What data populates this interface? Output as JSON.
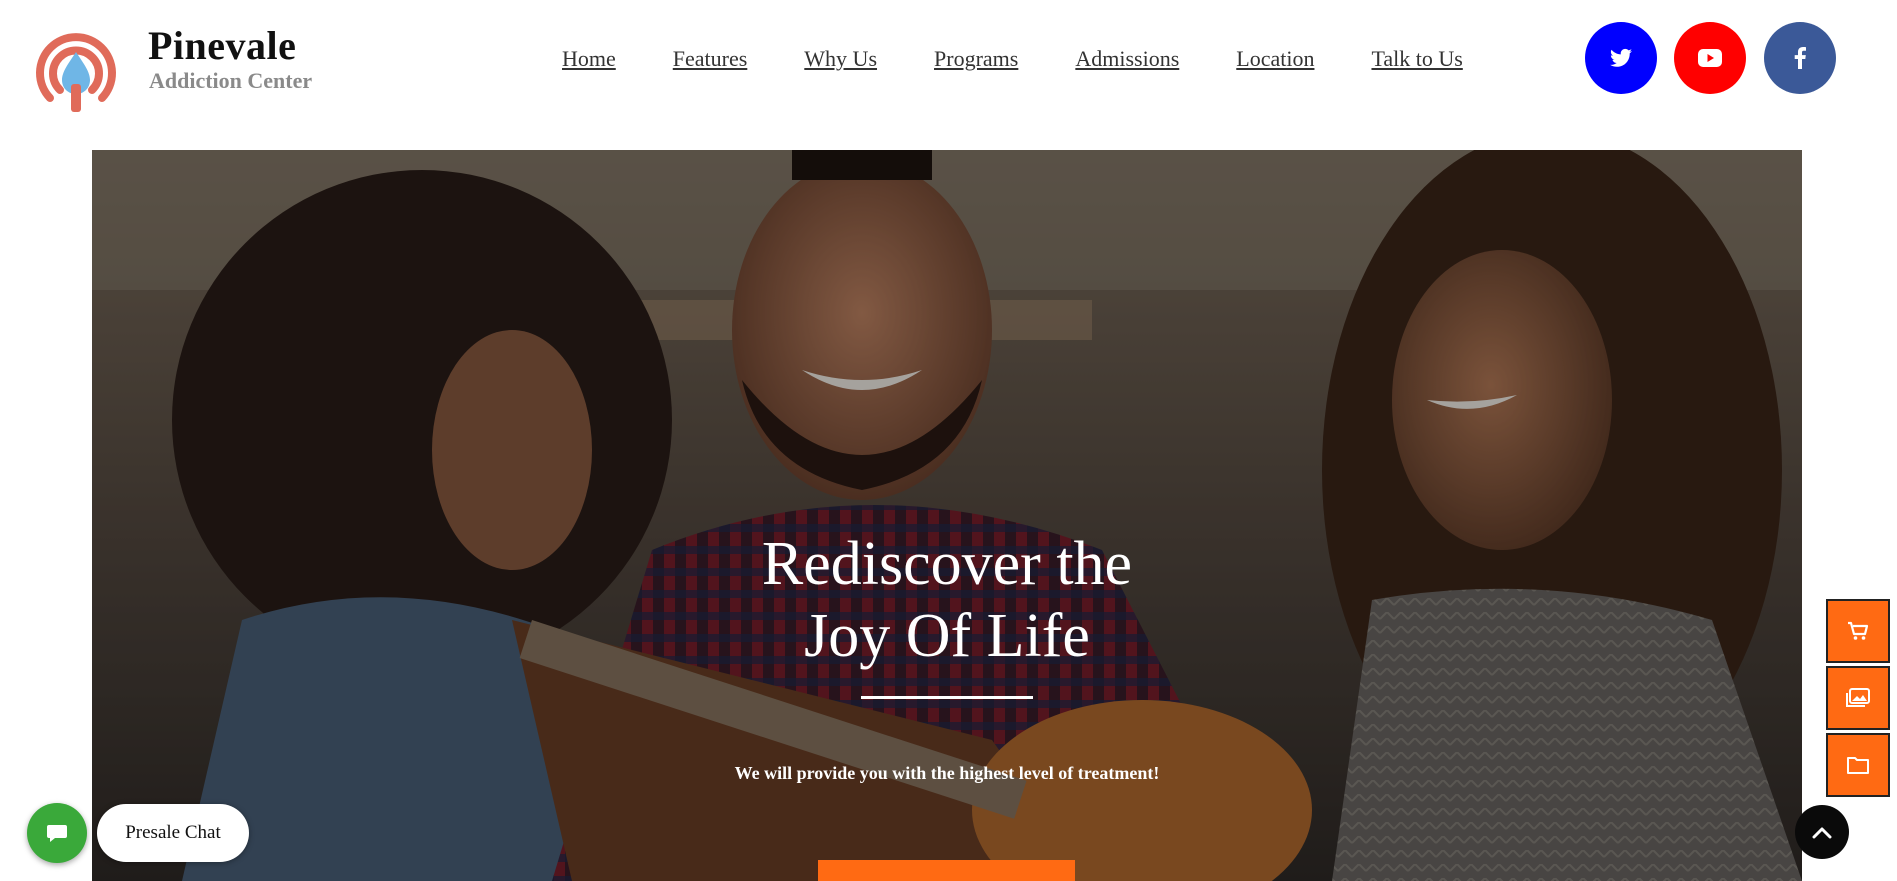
{
  "brand": {
    "name": "Pinevale",
    "subtitle": "Addiction Center",
    "logo_icon": "water-drop-rings-icon"
  },
  "nav": {
    "items": [
      {
        "label": "Home"
      },
      {
        "label": "Features"
      },
      {
        "label": "Why Us"
      },
      {
        "label": "Programs"
      },
      {
        "label": "Admissions"
      },
      {
        "label": "Location"
      },
      {
        "label": "Talk to Us"
      }
    ]
  },
  "social": [
    {
      "icon": "twitter-icon",
      "color": "#0000ff"
    },
    {
      "icon": "youtube-icon",
      "color": "#ff0000"
    },
    {
      "icon": "facebook-icon",
      "color": "#3b5998"
    }
  ],
  "hero": {
    "title_line1": "Rediscover the",
    "title_line2": "Joy Of Life",
    "tagline": "We will provide you with the highest level of treatment!",
    "cta_color": "#ff6a13"
  },
  "side_buttons": [
    {
      "icon": "cart-icon"
    },
    {
      "icon": "images-icon"
    },
    {
      "icon": "folder-icon"
    }
  ],
  "chat": {
    "label": "Presale Chat",
    "icon": "chat-bubble-icon",
    "color": "#3aa93a"
  },
  "scroll_top": {
    "icon": "chevron-up-icon"
  },
  "colors": {
    "accent": "#ff6a13",
    "logo": "#e06b5a",
    "drop": "#6fb6e6"
  }
}
